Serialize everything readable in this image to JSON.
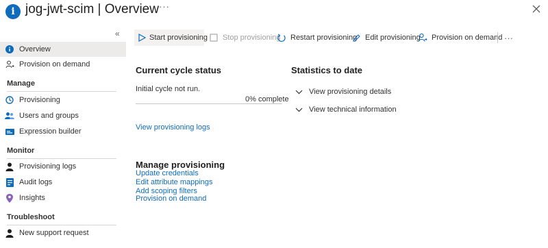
{
  "header": {
    "app_name": "jog-jwt-scim",
    "separator": " | ",
    "page": "Overview",
    "more": "···"
  },
  "sidebar": {
    "collapse_glyph": "«",
    "top_items": [
      {
        "label": "Overview",
        "icon": "info-icon",
        "active": true
      },
      {
        "label": "Provision on demand",
        "icon": "user-provision-icon"
      }
    ],
    "sections": [
      {
        "title": "Manage",
        "items": [
          {
            "label": "Provisioning",
            "icon": "provisioning-icon"
          },
          {
            "label": "Users and groups",
            "icon": "users-icon"
          },
          {
            "label": "Expression builder",
            "icon": "expression-icon"
          }
        ]
      },
      {
        "title": "Monitor",
        "items": [
          {
            "label": "Provisioning logs",
            "icon": "person-log-icon"
          },
          {
            "label": "Audit logs",
            "icon": "audit-log-icon"
          },
          {
            "label": "Insights",
            "icon": "insights-icon"
          }
        ]
      },
      {
        "title": "Troubleshoot",
        "items": [
          {
            "label": "New support request",
            "icon": "support-icon"
          }
        ]
      }
    ]
  },
  "toolbar": {
    "start": "Start provisioning",
    "stop": "Stop provisioning",
    "restart": "Restart provisioning",
    "edit": "Edit provisioning",
    "on_demand": "Provision on demand",
    "more": "···"
  },
  "status": {
    "title": "Current cycle status",
    "message": "Initial cycle not run.",
    "percent_label": "0% complete",
    "progress": 0,
    "logs_link": "View provisioning logs"
  },
  "stats": {
    "title": "Statistics to date",
    "details": "View provisioning details",
    "technical": "View technical information"
  },
  "manage": {
    "title": "Manage provisioning",
    "links": [
      "Update credentials",
      "Edit attribute mappings",
      "Add scoping filters",
      "Provision on demand"
    ]
  },
  "colors": {
    "accent": "#0f6cbd",
    "active_bg": "#edebe9"
  }
}
